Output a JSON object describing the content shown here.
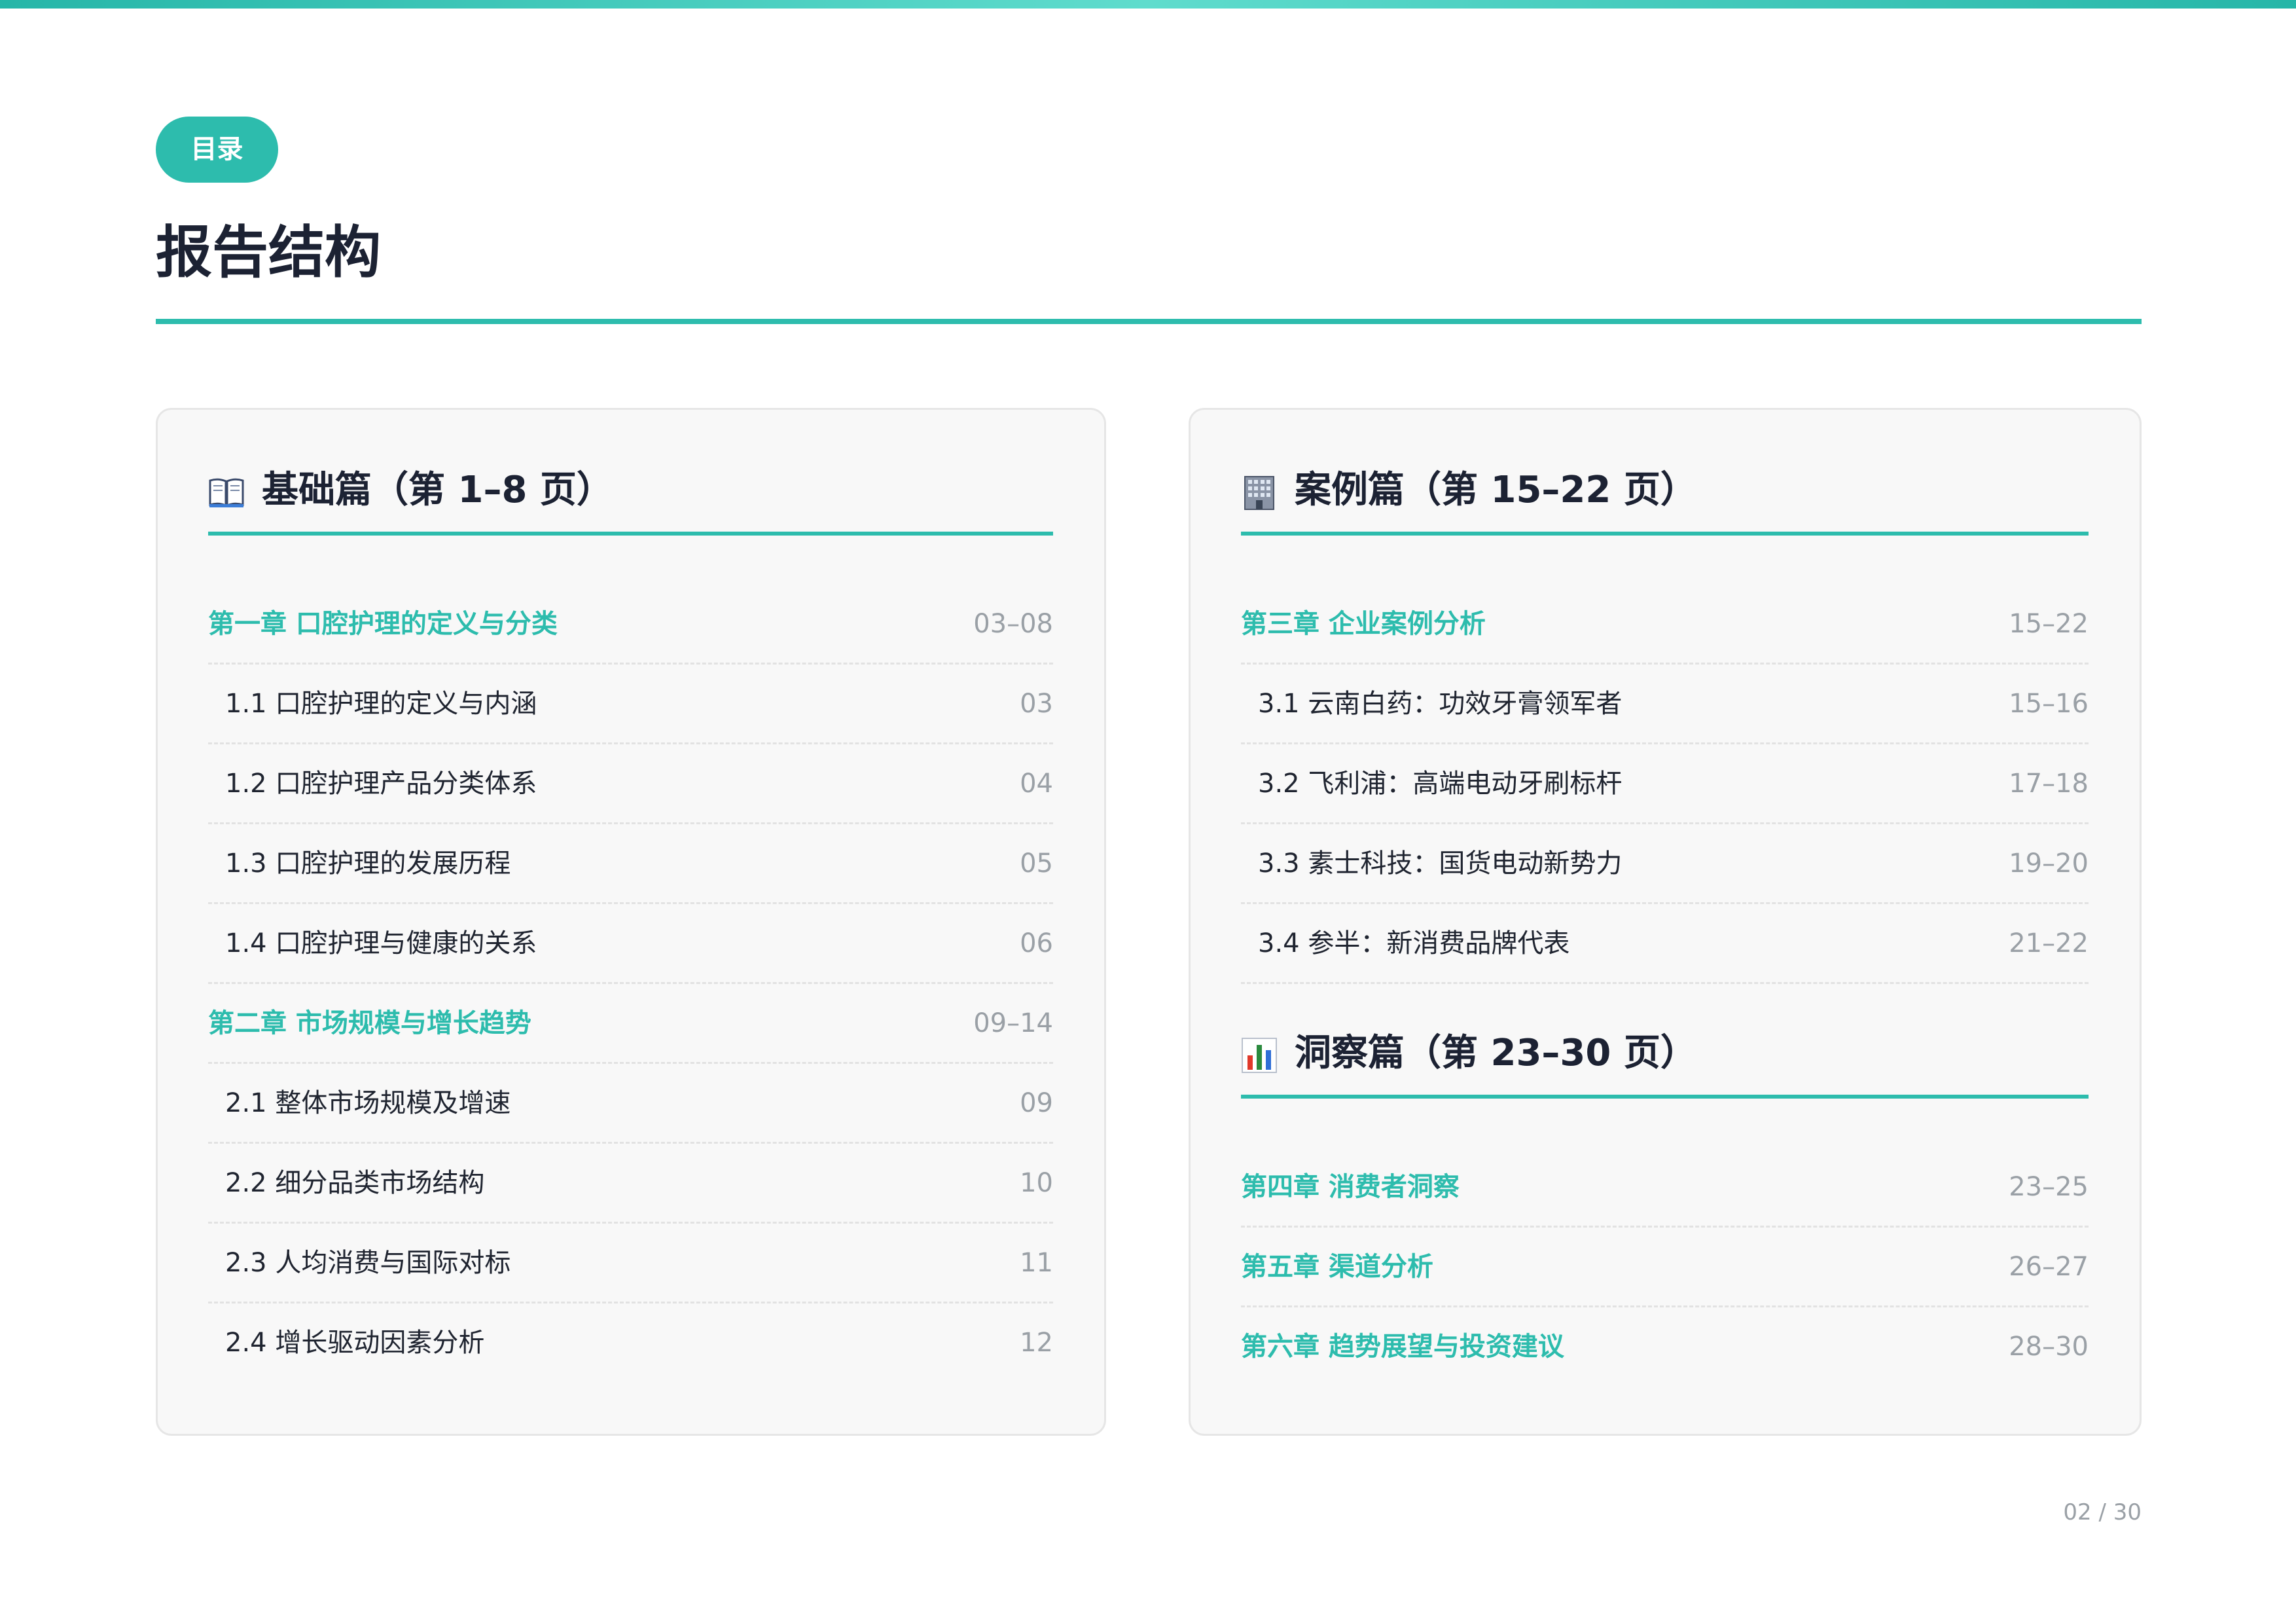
{
  "header": {
    "section_tag": "目录",
    "title": "报告结构"
  },
  "colors": {
    "accent": "#2dbcad",
    "text": "#1c2233",
    "muted": "#9aa0a6",
    "card_bg": "#f8f8f8"
  },
  "left_card": {
    "group": {
      "icon": "open-book-icon",
      "title": "基础篇（第 1–8 页）"
    },
    "rows": [
      {
        "type": "chapter",
        "label": "第一章 口腔护理的定义与分类",
        "pages": "03–08"
      },
      {
        "type": "sub",
        "label": "1.1 口腔护理的定义与内涵",
        "pages": "03"
      },
      {
        "type": "sub",
        "label": "1.2 口腔护理产品分类体系",
        "pages": "04"
      },
      {
        "type": "sub",
        "label": "1.3 口腔护理的发展历程",
        "pages": "05"
      },
      {
        "type": "sub",
        "label": "1.4 口腔护理与健康的关系",
        "pages": "06"
      },
      {
        "type": "chapter",
        "label": "第二章 市场规模与增长趋势",
        "pages": "09–14"
      },
      {
        "type": "sub",
        "label": "2.1 整体市场规模及增速",
        "pages": "09"
      },
      {
        "type": "sub",
        "label": "2.2 细分品类市场结构",
        "pages": "10"
      },
      {
        "type": "sub",
        "label": "2.3 人均消费与国际对标",
        "pages": "11"
      },
      {
        "type": "sub",
        "label": "2.4 增长驱动因素分析",
        "pages": "12"
      }
    ]
  },
  "right_card": {
    "groups": [
      {
        "icon": "office-building-icon",
        "title": "案例篇（第 15–22 页）",
        "rows": [
          {
            "type": "chapter",
            "label": "第三章 企业案例分析",
            "pages": "15–22"
          },
          {
            "type": "sub",
            "label": "3.1 云南白药：功效牙膏领军者",
            "pages": "15–16"
          },
          {
            "type": "sub",
            "label": "3.2 飞利浦：高端电动牙刷标杆",
            "pages": "17–18"
          },
          {
            "type": "sub",
            "label": "3.3 素士科技：国货电动新势力",
            "pages": "19–20"
          },
          {
            "type": "sub",
            "label": "3.4 参半：新消费品牌代表",
            "pages": "21–22"
          }
        ]
      },
      {
        "icon": "bar-chart-icon",
        "title": "洞察篇（第 23–30 页）",
        "rows": [
          {
            "type": "chapter",
            "label": "第四章 消费者洞察",
            "pages": "23–25"
          },
          {
            "type": "chapter",
            "label": "第五章 渠道分析",
            "pages": "26–27"
          },
          {
            "type": "chapter",
            "label": "第六章 趋势展望与投资建议",
            "pages": "28–30"
          }
        ]
      }
    ]
  },
  "footer": {
    "page_indicator": "02 / 30"
  }
}
